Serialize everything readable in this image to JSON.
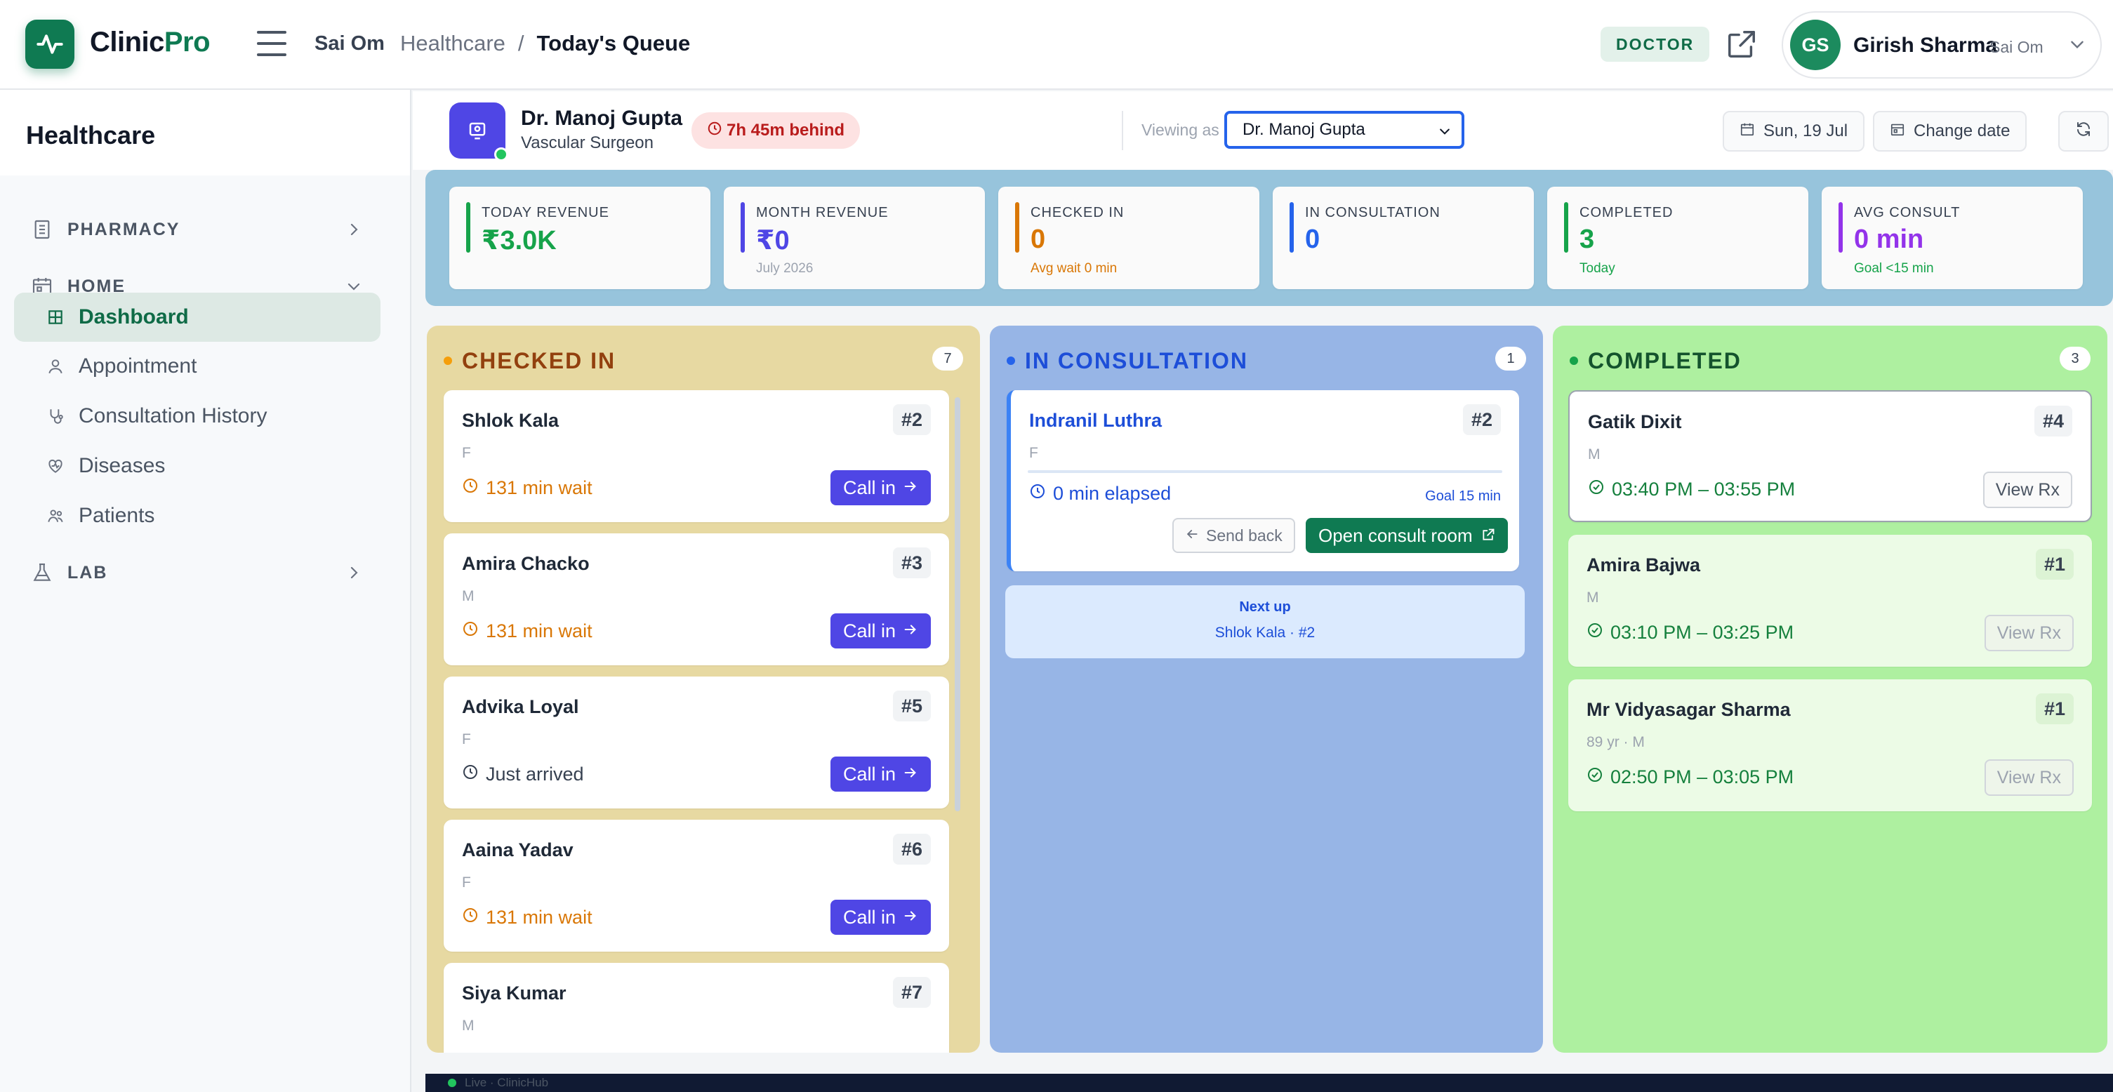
{
  "header": {
    "brand_prefix": "Clinic",
    "brand_suffix": "Pro",
    "org": "Sai Om",
    "breadcrumb": [
      "Healthcare",
      "Today's Queue"
    ],
    "breadcrumb_sep": "/",
    "role": "DOCTOR",
    "user": {
      "initials": "GS",
      "name": "Girish Sharma",
      "org": "Sai Om"
    }
  },
  "sidebar": {
    "title": "Healthcare",
    "sections": [
      {
        "label": "PHARMACY",
        "icon": "building-icon",
        "expanded": false
      },
      {
        "label": "HOME",
        "icon": "calendar-icon",
        "expanded": true
      },
      {
        "label": "LAB",
        "icon": "flask-icon",
        "expanded": false
      }
    ],
    "items": [
      {
        "label": "Dashboard",
        "icon": "grid-icon",
        "active": true
      },
      {
        "label": "Appointment",
        "icon": "user-icon",
        "active": false
      },
      {
        "label": "Consultation History",
        "icon": "stethoscope-icon",
        "active": false
      },
      {
        "label": "Diseases",
        "icon": "heart-icon",
        "active": false
      },
      {
        "label": "Patients",
        "icon": "users-icon",
        "active": false
      }
    ]
  },
  "doctor_bar": {
    "name": "Dr. Manoj Gupta",
    "specialty": "Vascular Surgeon",
    "behind": "7h 45m behind",
    "viewing_label": "Viewing as",
    "viewing_value": "Dr. Manoj Gupta",
    "date_label": "Sun, 19 Jul",
    "change_date_label": "Change date"
  },
  "stats": [
    {
      "label": "TODAY REVENUE",
      "value": "₹3.0K",
      "sub": "",
      "accent": "#16a34a"
    },
    {
      "label": "MONTH REVENUE",
      "value": "₹0",
      "sub": "July 2026",
      "accent": "#4f46e5"
    },
    {
      "label": "CHECKED IN",
      "value": "0",
      "sub": "Avg wait 0 min",
      "accent": "#d97706"
    },
    {
      "label": "IN CONSULTATION",
      "value": "0",
      "sub": "",
      "accent": "#2563eb"
    },
    {
      "label": "COMPLETED",
      "value": "3",
      "sub": "Today",
      "accent": "#16a34a"
    },
    {
      "label": "AVG CONSULT",
      "value": "0 min",
      "sub": "Goal <15 min",
      "accent": "#9333ea"
    }
  ],
  "columns": {
    "checked_in": {
      "title": "CHECKED IN",
      "count": "7",
      "cards": [
        {
          "name": "Shlok Kala",
          "token": "#2",
          "meta": "F",
          "wait": "131 min wait",
          "action": "Call in"
        },
        {
          "name": "Amira Chacko",
          "token": "#3",
          "meta": "M",
          "wait": "131 min wait",
          "action": "Call in"
        },
        {
          "name": "Advika Loyal",
          "token": "#5",
          "meta": "F",
          "wait": "Just arrived",
          "action": "Call in"
        },
        {
          "name": "Aaina Yadav",
          "token": "#6",
          "meta": "F",
          "wait": "131 min wait",
          "action": "Call in"
        },
        {
          "name": "Siya Kumar",
          "token": "#7",
          "meta": "M",
          "wait": "",
          "action": ""
        }
      ]
    },
    "in_consultation": {
      "title": "IN CONSULTATION",
      "count": "1",
      "card": {
        "name": "Indranil Luthra",
        "token": "#2",
        "meta": "F",
        "elapsed": "0 min elapsed",
        "goal": "Goal 15 min",
        "progress": 0,
        "send_back": "Send back",
        "open_room": "Open consult room"
      },
      "next_up_label": "Next up",
      "next_up_value": "Shlok Kala · #2"
    },
    "completed": {
      "title": "COMPLETED",
      "count": "3",
      "cards": [
        {
          "name": "Gatik Dixit",
          "token": "#4",
          "meta": "M",
          "time": "03:40 PM – 03:55 PM",
          "action": "View Rx"
        },
        {
          "name": "Amira Bajwa",
          "token": "#1",
          "meta": "M",
          "time": "03:10 PM – 03:25 PM",
          "action": "View Rx"
        },
        {
          "name": "Mr Vidyasagar Sharma",
          "token": "#1",
          "meta": "89 yr · M",
          "time": "02:50 PM – 03:05 PM",
          "action": "View Rx"
        }
      ]
    }
  },
  "footer": {
    "status": "Live · ClinicHub"
  },
  "colors": {
    "brand": "#0f7a52",
    "checked_in_bg": "#e7d9a2",
    "consult_bg": "#97b5e6",
    "completed_bg": "#aef0a0",
    "call_in": "#4f46e5",
    "open_room": "#0f7a52"
  }
}
